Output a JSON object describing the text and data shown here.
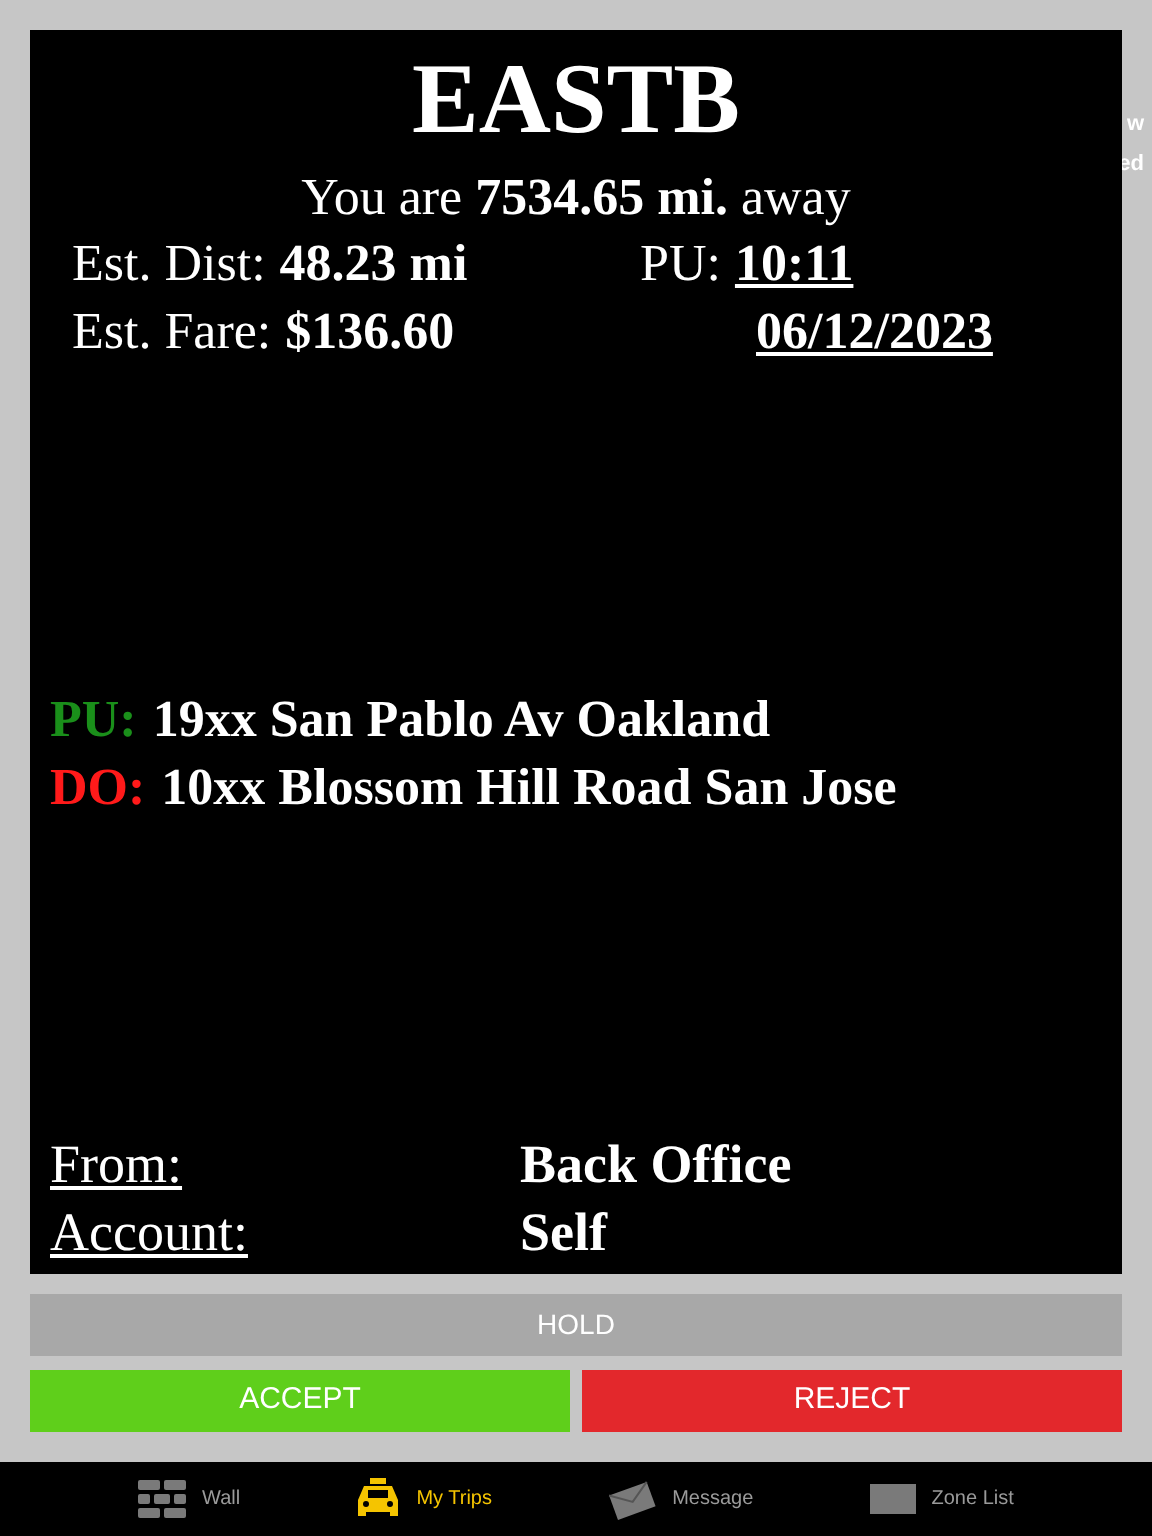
{
  "background_fragments": [
    "w",
    "ed"
  ],
  "trip": {
    "title": "EASTB",
    "distance_line": "You are **7534.65 mi.** away",
    "est_dist_label": "Est. Dist:",
    "est_dist": "48.23 mi",
    "pu_time_label": "PU:",
    "pu_time": "10:11",
    "est_fare_label": "Est. Fare:",
    "est_fare": "$136.60",
    "date": "06/12/2023",
    "stops": [
      {
        "label": "PU:",
        "color": "#1a8f1a",
        "address": "19xx San Pablo Av Oakland"
      },
      {
        "label": "DO:",
        "color": "#ff1a1a",
        "address": "10xx Blossom Hill Road San Jose"
      }
    ],
    "details": [
      {
        "label": "From:",
        "value": "Back Office"
      },
      {
        "label": "Account:",
        "value": "Self"
      }
    ]
  },
  "hold_button": "HOLD",
  "accept_button": "ACCEPT",
  "reject_button": "REJECT",
  "tabs": [
    {
      "kind": "wall",
      "label": "Wall",
      "selected": false
    },
    {
      "kind": "taxi",
      "label": "My Trips",
      "selected": true
    },
    {
      "kind": "message",
      "label": "Message",
      "selected": false
    },
    {
      "kind": "zones",
      "label": "Zone List",
      "selected": false
    }
  ]
}
